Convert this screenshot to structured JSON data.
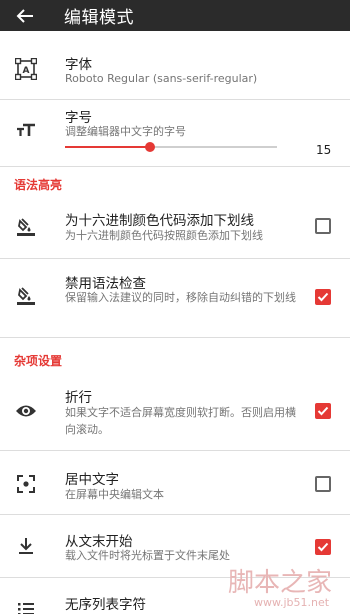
{
  "appbar": {
    "title": "编辑模式"
  },
  "font": {
    "title": "字体",
    "subtitle": "Roboto Regular (sans-serif-regular)"
  },
  "fontsize": {
    "title": "字号",
    "subtitle": "调整编辑器中文字的字号",
    "value": "15",
    "level": 0.4
  },
  "sections": {
    "syntax": "语法高亮",
    "misc": "杂项设置"
  },
  "underline_hex": {
    "title": "为十六进制颜色代码添加下划线",
    "subtitle": "为十六进制颜色代码按照颜色添加下划线",
    "checked": false
  },
  "disable_spell": {
    "title": "禁用语法检查",
    "subtitle": "保留输入法建议的同时，移除自动纠错的下划线",
    "checked": true
  },
  "wrap": {
    "title": "折行",
    "subtitle": "如果文字不适合屏幕宽度则软打断。否则启用横向滚动。",
    "checked": true
  },
  "center": {
    "title": "居中文字",
    "subtitle": "在屏幕中央编辑文本",
    "checked": false
  },
  "from_end": {
    "title": "从文末开始",
    "subtitle": "载入文件时将光标置于文件末尾处",
    "checked": true
  },
  "bullet": {
    "title": "无序列表字符"
  },
  "watermark": {
    "main": "脚本之家",
    "url": "www.jb51.net"
  },
  "colors": {
    "accent": "#e53935",
    "appbar": "#2b2b2b"
  }
}
